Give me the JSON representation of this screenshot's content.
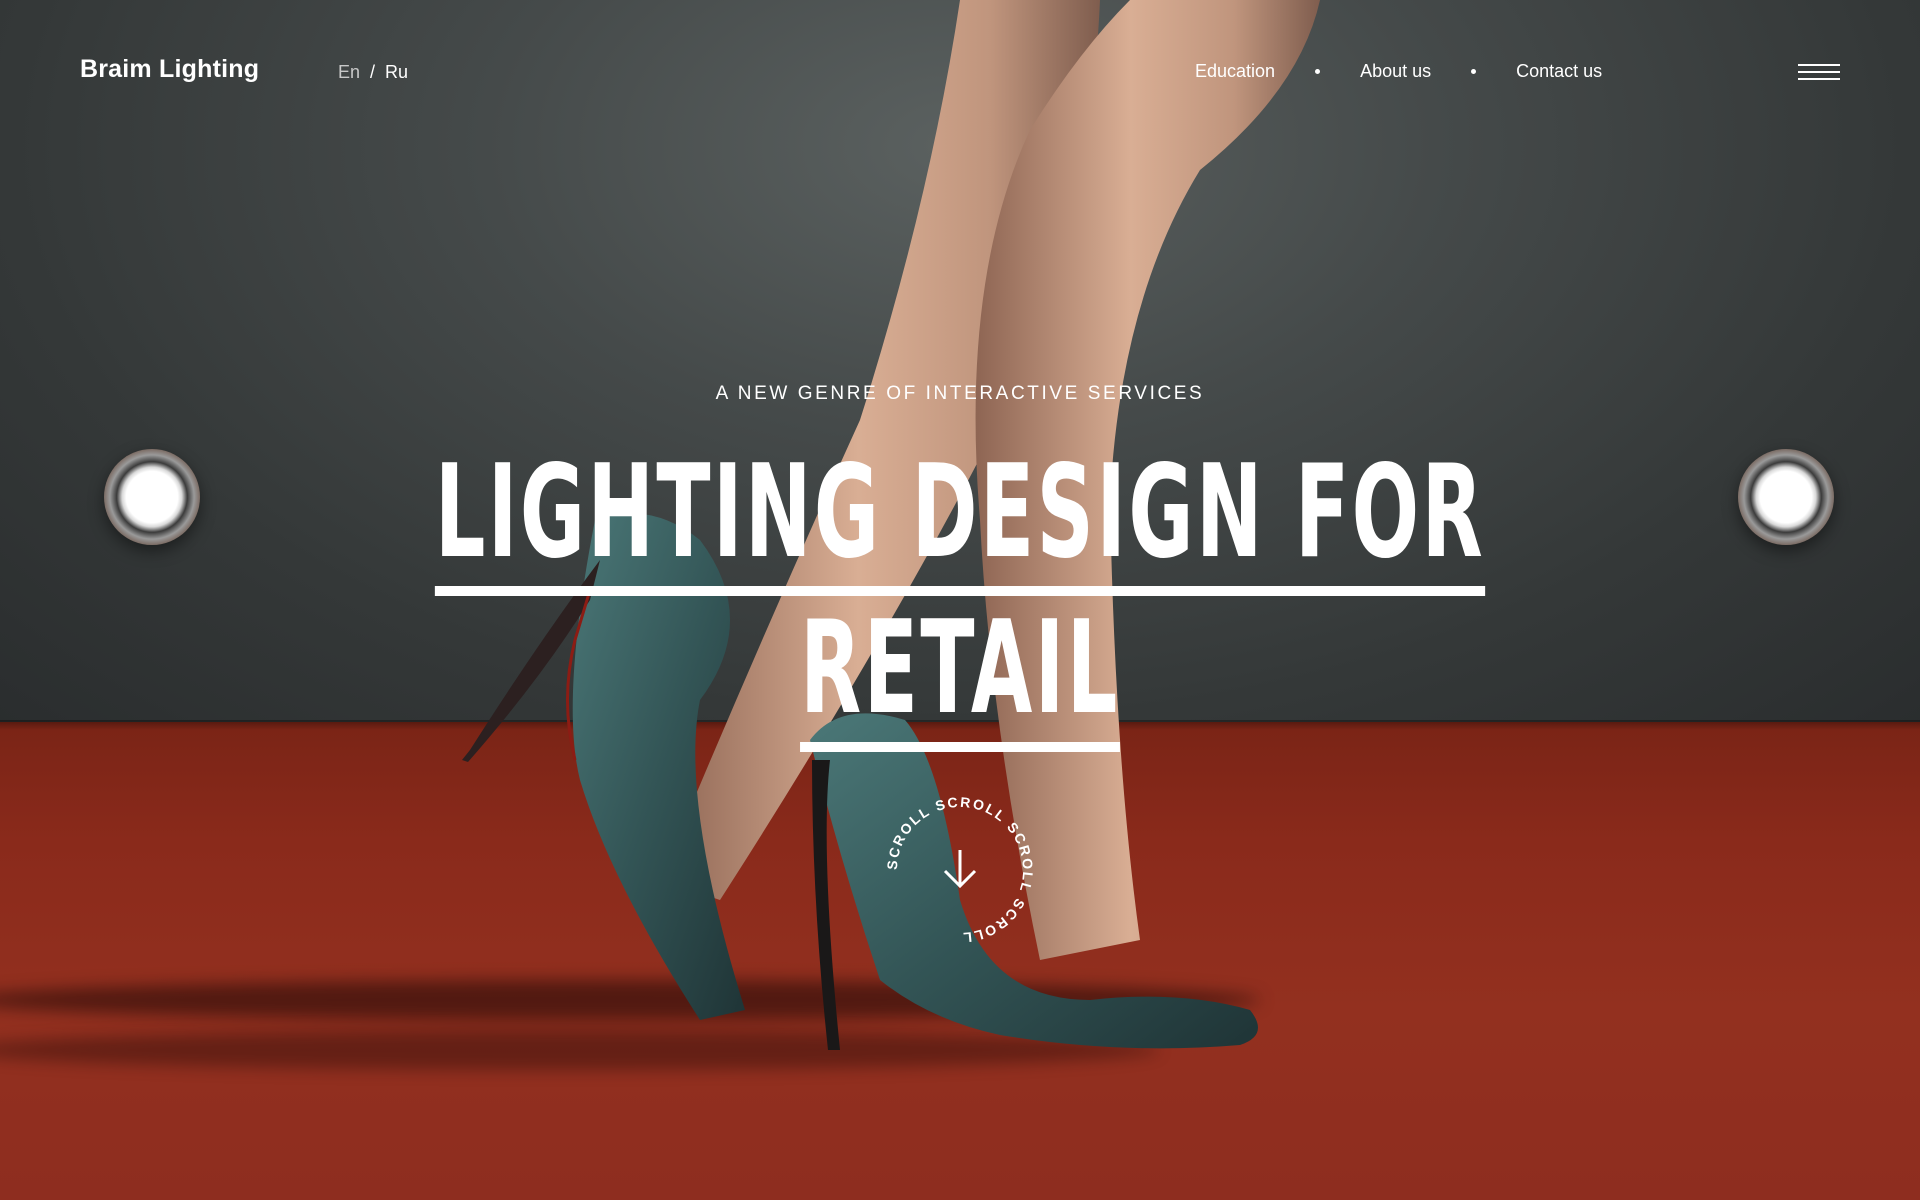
{
  "header": {
    "logo": "Braim Lighting",
    "lang": {
      "en": "En",
      "separator": "/",
      "ru": "Ru"
    },
    "nav": [
      {
        "label": "Education"
      },
      {
        "label": "About us"
      },
      {
        "label": "Contact us"
      }
    ],
    "menu_icon": "hamburger-menu-icon"
  },
  "hero": {
    "eyebrow": "A NEW GENRE OF INTERACTIVE SERVICES",
    "headline_line1": "LIGHTING DESIGN FOR",
    "headline_line2": "RETAIL"
  },
  "scroll": {
    "ring_text": "SCROLL SCROLL SCROLL SCROLL",
    "icon": "arrow-down-icon"
  },
  "colors": {
    "wall": "#3f4444",
    "floor": "#8a2a1b",
    "text": "#ffffff"
  }
}
